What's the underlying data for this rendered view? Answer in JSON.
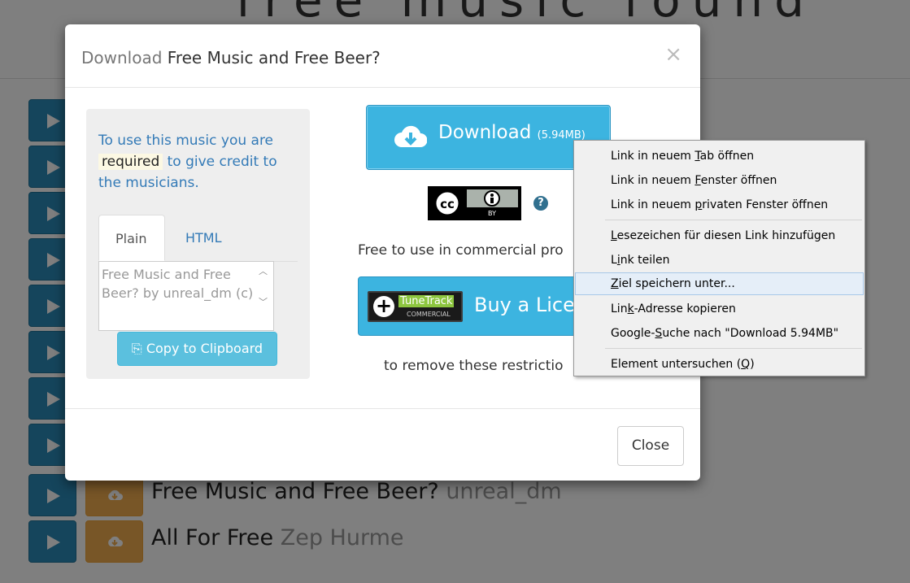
{
  "background": {
    "header_title": "free music found",
    "tracks": [
      {
        "title": "Free Music and Free Beer?",
        "artist": "unreal_dm"
      },
      {
        "title": "All For Free",
        "artist": "Zep Hurme"
      }
    ]
  },
  "modal": {
    "title_prefix": "Download",
    "title_main": "Free Music and Free Beer?",
    "close_x": "×",
    "credit": {
      "line1": "To use this music you are",
      "required": "required",
      "line2": " to give credit to the musicians."
    },
    "tabs": [
      "Plain",
      "HTML"
    ],
    "code_text": "Free Music and Free Beer? by unreal_dm (c)",
    "copy_label": "Copy to Clipboard",
    "download_label": "Download",
    "download_size": "(5.94MB)",
    "cc_license": "BY",
    "help_glyph": "?",
    "free_text": "Free to use in commercial pro",
    "tunetrack_name": "TuneTrack",
    "tunetrack_sub": "COMMERCIAL",
    "license_label": "Buy a Licen",
    "remove_text": "to remove these restrictio",
    "close_label": "Close"
  },
  "context_menu": {
    "items": [
      "Link in neuem Tab öffnen",
      "Link in neuem Fenster öffnen",
      "Link in neuem privaten Fenster öffnen",
      "Lesezeichen für diesen Link hinzufügen",
      "Link teilen",
      "Ziel speichern unter...",
      "Link-Adresse kopieren",
      "Google-Suche nach \"Download 5.94MB\"",
      "Element untersuchen (Q)"
    ],
    "highlighted_index": 5
  },
  "colors": {
    "accent_blue": "#3cb4e0",
    "play_blue": "#2a8bb8",
    "download_orange": "#f0ad4e",
    "link_blue": "#337ab7"
  }
}
